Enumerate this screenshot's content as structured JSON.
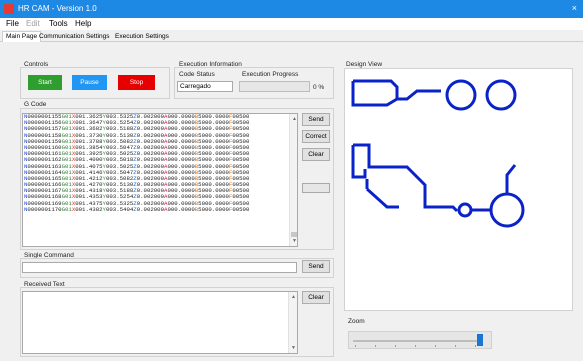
{
  "window": {
    "title": "HR CAM - Version 1.0",
    "close_glyph": "×"
  },
  "menu": {
    "items": [
      "File",
      "Edit",
      "Tools",
      "Help"
    ]
  },
  "tabs": [
    "Main Page",
    "Communication Settings",
    "Execution Settings"
  ],
  "controls": {
    "group_label": "Controls",
    "start_label": "Start",
    "pause_label": "Pause",
    "stop_label": "Stop"
  },
  "execution": {
    "group_label": "Execution Information",
    "code_status_label": "Code Status",
    "code_status_value": "Carregado",
    "progress_label": "Execution Progress",
    "progress_value": "0 %",
    "progress_fraction": 0
  },
  "gcode": {
    "group_label": "G Code",
    "send_label": "Send",
    "correct_label": "Correct",
    "clear_label": "Clear",
    "lines": [
      {
        "n": "N0000001155",
        "x": "001.3625",
        "y": "003.5325",
        "z": "0.002000",
        "a": "000.0000",
        "b": "5000.0000",
        "f": "00500"
      },
      {
        "n": "N0000001156",
        "x": "001.3647",
        "y": "003.5254",
        "z": "0.002000",
        "a": "000.0000",
        "b": "5000.0000",
        "f": "00500"
      },
      {
        "n": "N0000001157",
        "x": "001.3682",
        "y": "003.5188",
        "z": "0.002000",
        "a": "000.0000",
        "b": "5000.0000",
        "f": "00500"
      },
      {
        "n": "N0000001158",
        "x": "001.3730",
        "y": "003.5130",
        "z": "0.002000",
        "a": "000.0000",
        "b": "5000.0000",
        "f": "00500"
      },
      {
        "n": "N0000001159",
        "x": "001.3788",
        "y": "003.5082",
        "z": "0.002000",
        "a": "000.0000",
        "b": "5000.0000",
        "f": "00500"
      },
      {
        "n": "N0000001160",
        "x": "001.3854",
        "y": "003.5047",
        "z": "0.002000",
        "a": "000.0000",
        "b": "5000.0000",
        "f": "00500"
      },
      {
        "n": "N0000001161",
        "x": "001.3925",
        "y": "003.5025",
        "z": "0.002000",
        "a": "000.0000",
        "b": "5000.0000",
        "f": "00500"
      },
      {
        "n": "N0000001162",
        "x": "001.4000",
        "y": "003.5018",
        "z": "0.002000",
        "a": "000.0000",
        "b": "5000.0000",
        "f": "00500"
      },
      {
        "n": "N0000001163",
        "x": "001.4075",
        "y": "003.5025",
        "z": "0.002000",
        "a": "000.0000",
        "b": "5000.0000",
        "f": "00500"
      },
      {
        "n": "N0000001164",
        "x": "001.4146",
        "y": "003.5047",
        "z": "0.002000",
        "a": "000.0000",
        "b": "5000.0000",
        "f": "00500"
      },
      {
        "n": "N0000001165",
        "x": "001.4212",
        "y": "003.5082",
        "z": "0.002000",
        "a": "000.0000",
        "b": "5000.0000",
        "f": "00500"
      },
      {
        "n": "N0000001166",
        "x": "001.4270",
        "y": "003.5130",
        "z": "0.002000",
        "a": "000.0000",
        "b": "5000.0000",
        "f": "00500"
      },
      {
        "n": "N0000001167",
        "x": "001.4318",
        "y": "003.5188",
        "z": "0.002000",
        "a": "000.0000",
        "b": "5000.0000",
        "f": "00500"
      },
      {
        "n": "N0000001168",
        "x": "001.4353",
        "y": "003.5254",
        "z": "0.002000",
        "a": "000.0000",
        "b": "5000.0000",
        "f": "00500"
      },
      {
        "n": "N0000001169",
        "x": "001.4375",
        "y": "003.5325",
        "z": "0.002000",
        "a": "000.0000",
        "b": "5000.0000",
        "f": "00500"
      },
      {
        "n": "N0000001170",
        "x": "001.4382",
        "y": "003.5404",
        "z": "0.002000",
        "a": "000.0000",
        "b": "5000.0000",
        "f": "00500"
      }
    ]
  },
  "single_command": {
    "group_label": "Single Command",
    "value": "",
    "send_label": "Send"
  },
  "received": {
    "group_label": "Received Text",
    "value": "",
    "clear_label": "Clear"
  },
  "design_view": {
    "group_label": "Design View",
    "stroke_color": "#0a23c8"
  },
  "zoom": {
    "label": "Zoom",
    "value_fraction": 0.95
  },
  "colors": {
    "titlebar": "#1e88e5",
    "start": "#2e9e2e",
    "pause": "#2196f3",
    "stop": "#e60000"
  }
}
